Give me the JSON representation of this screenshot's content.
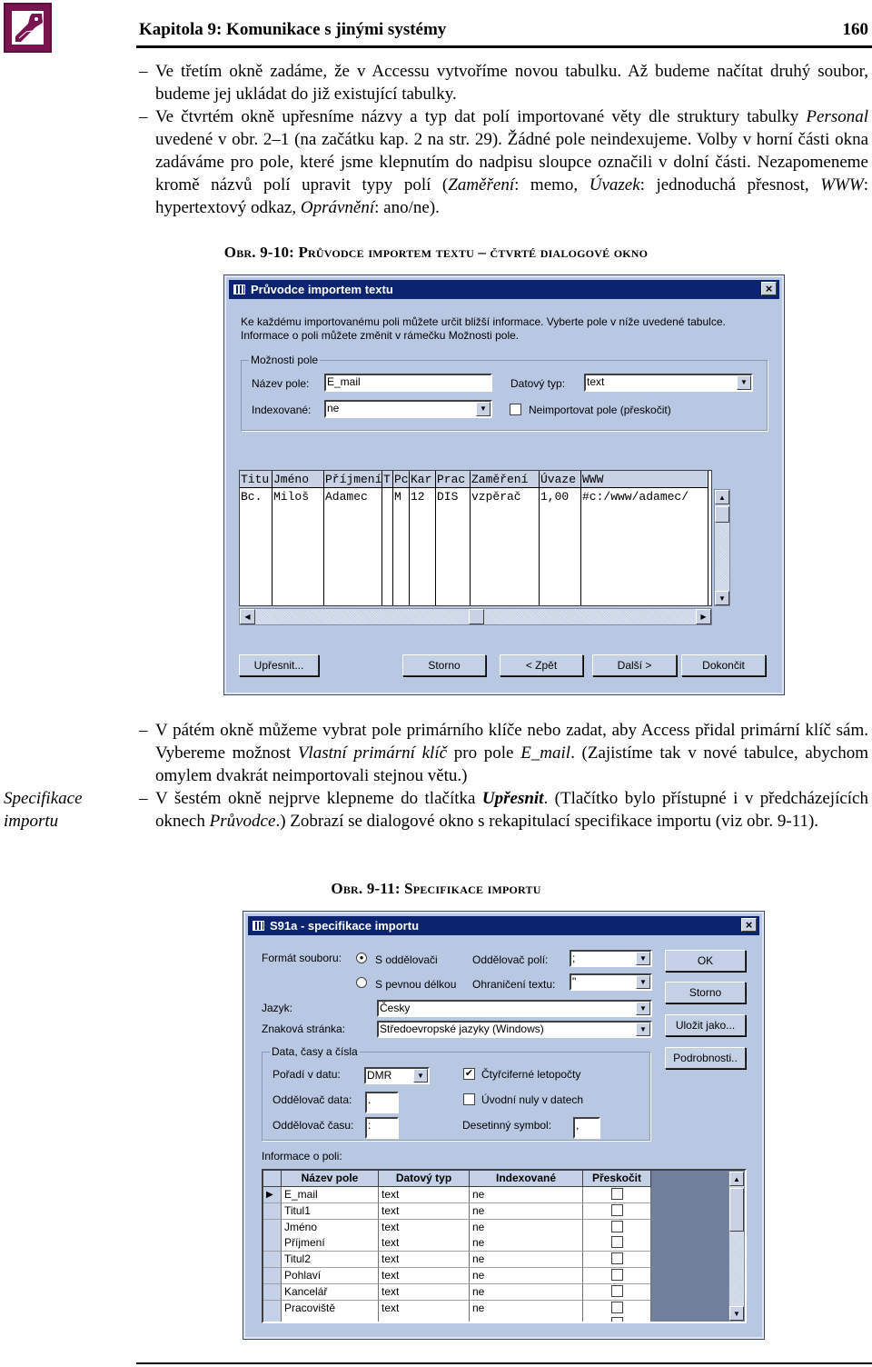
{
  "header": {
    "chapter_title": "Kapitola 9: Komunikace s jinými systémy",
    "page_number": "160",
    "logo_icon": "access-key-icon",
    "logo_color": "#7a1450"
  },
  "paragraphs": [
    {
      "segments": [
        {
          "t": "Ve třetím okně zadáme, že v Accessu vytvoříme novou tabulku. Až budeme načítat druhý soubor, budeme jej ukládat do již existující tabulky."
        }
      ]
    },
    {
      "segments": [
        {
          "t": "Ve čtvrtém okně upřesníme názvy a typ dat polí importované věty dle struktury tabulky "
        },
        {
          "t": "Personal",
          "s": "i"
        },
        {
          "t": " uvedené v obr. 2–1 (na začátku kap. 2 na str. 29). Žádné pole neindexujeme. Volby v horní části okna zadáváme pro pole, které jsme klepnutím do nadpisu sloupce označili v dolní části. Nezapomeneme kromě názvů polí upravit typy polí ("
        },
        {
          "t": "Zaměření",
          "s": "i"
        },
        {
          "t": ": memo, "
        },
        {
          "t": "Úvazek",
          "s": "i"
        },
        {
          "t": ": jednoduchá přesnost, "
        },
        {
          "t": "WWW",
          "s": "i"
        },
        {
          "t": ": hypertextový odkaz, "
        },
        {
          "t": "Oprávnění",
          "s": "i"
        },
        {
          "t": ": ano/ne)."
        }
      ]
    },
    {
      "segments": [
        {
          "t": "V pátém okně můžeme vybrat pole primárního klíče nebo zadat, aby Access přidal primární klíč sám. Vybereme možnost "
        },
        {
          "t": "Vlastní primární klíč",
          "s": "i"
        },
        {
          "t": " pro pole "
        },
        {
          "t": "E_mail",
          "s": "i"
        },
        {
          "t": ". (Zajistíme tak v nové tabulce, abychom omylem dvakrát neimportovali stejnou větu.)"
        }
      ]
    },
    {
      "segments": [
        {
          "t": "V šestém okně nejprve klepneme do tlačítka "
        },
        {
          "t": "Upřesnit",
          "s": "bi"
        },
        {
          "t": ". (Tlačítko bylo přístupné i v předcházejících oknech "
        },
        {
          "t": "Průvodce",
          "s": "i"
        },
        {
          "t": ".) Zobrazí se dialogové okno s rekapitulací specifikace importu (viz obr. 9-11)."
        }
      ]
    }
  ],
  "bullet": "–",
  "margin_note": {
    "line1": "Specifikace",
    "line2": "importu"
  },
  "captions": {
    "fig10": "Obr. 9-10: Průvodce importem textu – čtvrté dialogové okno",
    "fig11": "Obr. 9-11: Specifikace importu"
  },
  "dialog1": {
    "title": "Průvodce importem textu",
    "close": "×",
    "intro_line1": "Ke každému importovanému poli můžete určit bližší informace. Vyberte pole v níže uvedené tabulce.",
    "intro_line2": "Informace o poli můžete změnit v rámečku Možnosti pole.",
    "group_title": "Možnosti pole",
    "field_name_label": "Název pole:",
    "field_name_value": "E_mail",
    "data_type_label": "Datový typ:",
    "data_type_value": "text",
    "indexed_label": "Indexované:",
    "indexed_value": "ne",
    "skip_label": "Neimportovat pole (přeskočit)",
    "skip_checked": false,
    "grid": {
      "headers": [
        "Titu",
        "Jméno",
        "Příjmení",
        "T",
        "Pc",
        "Kar",
        "Prac",
        "Zaměření",
        "Úvaze",
        "WWW"
      ],
      "row": [
        "Bc.",
        "Miloš",
        "Adamec",
        "",
        "M",
        "12",
        "DIS",
        "vzpěrač",
        "1,00",
        "#c:/www/adamec/"
      ]
    },
    "buttons": {
      "advanced": "Upřesnit...",
      "cancel": "Storno",
      "back": "< Zpět",
      "next": "Další >",
      "finish": "Dokončit"
    }
  },
  "dialog2": {
    "title": "S91a  - specifikace importu",
    "close": "×",
    "file_format_label": "Formát souboru:",
    "radio_delimited": "S oddělovači",
    "radio_fixed": "S pevnou délkou",
    "selected_format": "delimited",
    "field_delim_label": "Oddělovač polí:",
    "field_delim_value": ";",
    "text_qualifier_label": "Ohraničení textu:",
    "text_qualifier_value": "\"",
    "language_label": "Jazyk:",
    "language_value": "Česky",
    "codepage_label": "Znaková stránka:",
    "codepage_value": "Středoevropské jazyky (Windows)",
    "group_title": "Data, časy a čísla",
    "date_order_label": "Pořadí v datu:",
    "date_order_value": "DMR",
    "date_delim_label": "Oddělovač data:",
    "date_delim_value": ".",
    "time_delim_label": "Oddělovač času:",
    "time_delim_value": ":",
    "four_digit_years_label": "Čtyřciferné letopočty",
    "four_digit_years_checked": true,
    "leading_zeros_label": "Úvodní nuly v datech",
    "leading_zeros_checked": false,
    "decimal_symbol_label": "Desetinný symbol:",
    "decimal_symbol_value": ",",
    "buttons": {
      "ok": "OK",
      "cancel": "Storno",
      "save_as": "Uložit jako...",
      "details": "Podrobnosti.."
    },
    "field_info_label": "Informace o poli:",
    "grid": {
      "headers": [
        "Název pole",
        "Datový typ",
        "Indexované",
        "Přeskočit"
      ],
      "rows": [
        [
          "E_mail",
          "text",
          "ne",
          false
        ],
        [
          "Titul1",
          "text",
          "ne",
          false
        ],
        [
          "Jméno",
          "text",
          "ne",
          false
        ],
        [
          "Příjmení",
          "text",
          "ne",
          false
        ],
        [
          "Titul2",
          "text",
          "ne",
          false
        ],
        [
          "Pohlaví",
          "text",
          "ne",
          false
        ],
        [
          "Kancelář",
          "text",
          "ne",
          false
        ],
        [
          "Pracoviště",
          "text",
          "ne",
          false
        ]
      ]
    }
  }
}
